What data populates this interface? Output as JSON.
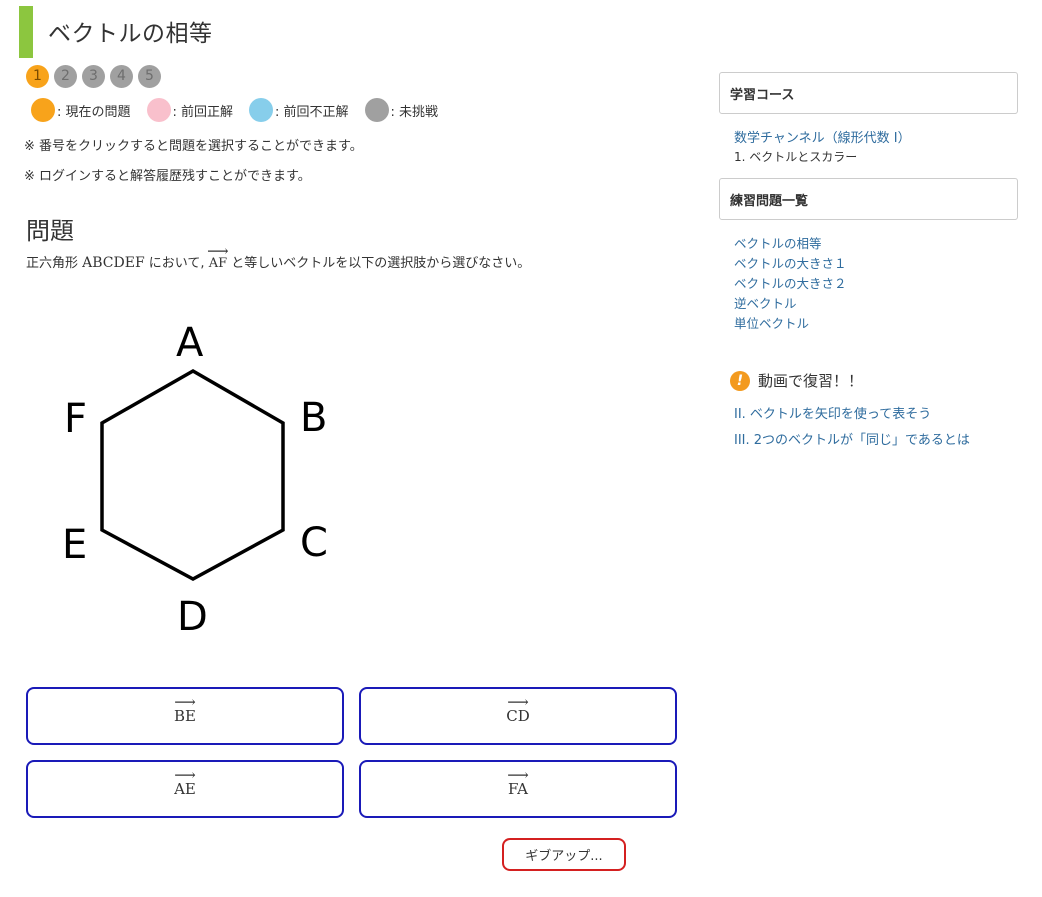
{
  "page": {
    "title": "ベクトルの相等"
  },
  "problem_numbers": [
    "1",
    "2",
    "3",
    "4",
    "5"
  ],
  "legend": [
    {
      "label": ": 現在の問題",
      "color": "#f8a31b"
    },
    {
      "label": ": 前回正解",
      "color": "#f9c0cc"
    },
    {
      "label": ": 前回不正解",
      "color": "#87ceeb"
    },
    {
      "label": ": 未挑戦",
      "color": "#a0a0a0"
    }
  ],
  "notes": [
    "※ 番号をクリックすると問題を選択することができます。",
    "※ ログインすると解答履歴残すことができます。"
  ],
  "problem": {
    "heading": "問題",
    "text_prefix": "正六角形 ",
    "shape_name": "ABCDEF",
    "text_mid": " において, ",
    "vector": "AF",
    "text_suffix": " と等しいベクトルを以下の選択肢から選びなさい。",
    "arrow": "⟶"
  },
  "hexagon_labels": {
    "a": "A",
    "b": "B",
    "c": "C",
    "d": "D",
    "e": "E",
    "f": "F"
  },
  "choices": [
    "BE",
    "CD",
    "AE",
    "FA"
  ],
  "giveup_label": "ギブアップ...",
  "sidebar": {
    "course_heading": "学習コース",
    "course_link": "数学チャンネル（線形代数 I）",
    "course_sub": "1. ベクトルとスカラー",
    "exercise_heading": "練習問題一覧",
    "exercises": [
      "ベクトルの相等",
      "ベクトルの大きさ１",
      "ベクトルの大きさ２",
      "逆ベクトル",
      "単位ベクトル"
    ],
    "review_icon": "!",
    "review_title": "動画で復習！！",
    "review_links": [
      "II. ベクトルを矢印を使って表そう",
      "III. 2つのベクトルが「同じ」であるとは"
    ]
  }
}
